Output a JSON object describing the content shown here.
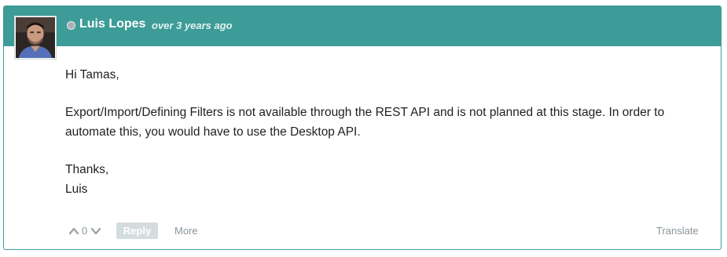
{
  "post": {
    "author": "Luis Lopes",
    "timestamp": "over 3 years ago",
    "status": "offline",
    "body": {
      "greeting": "Hi Tamas,",
      "paragraph_line1": "Export/Import/Defining Filters is not available through the REST API and is not planned at this stage. In order to",
      "paragraph_line2": "automate this, you would have to use the Desktop API.",
      "signoff": "Thanks,",
      "signature": "Luis"
    }
  },
  "footer": {
    "vote_count": "0",
    "reply_label": "Reply",
    "more_label": "More",
    "translate_label": "Translate"
  },
  "colors": {
    "header_bg": "#3d9c97",
    "border": "#3a9d98",
    "status_dot": "#a8b1b3",
    "reply_bg": "#d4dce0",
    "muted_text": "#8a959a"
  },
  "icons": {
    "status": "status-dot",
    "vote_up": "chevron-up-icon",
    "vote_down": "chevron-down-icon"
  }
}
